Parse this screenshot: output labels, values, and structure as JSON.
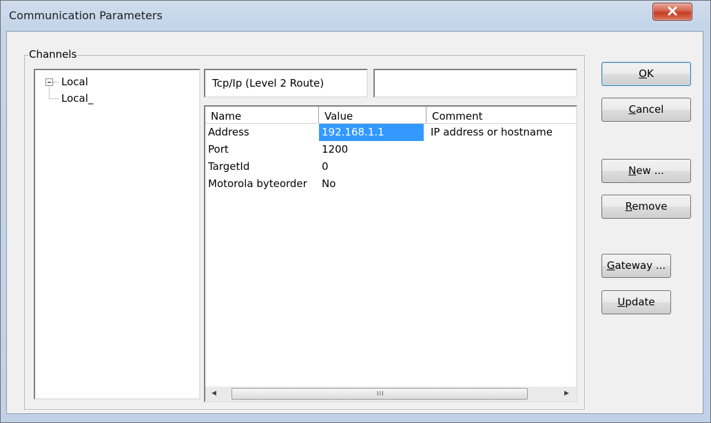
{
  "window": {
    "title": "Communication Parameters"
  },
  "channels": {
    "group_label": "Channels",
    "tree": [
      {
        "label": "Local",
        "expanded": true
      },
      {
        "label": "Local_"
      }
    ]
  },
  "channel_name": "Tcp/Ip (Level 2 Route)",
  "channel_description": "",
  "grid": {
    "columns": [
      "Name",
      "Value",
      "Comment"
    ],
    "rows": [
      {
        "name": "Address",
        "value": "192.168.1.1",
        "comment": "IP address or hostname"
      },
      {
        "name": "Port",
        "value": "1200",
        "comment": ""
      },
      {
        "name": "TargetId",
        "value": "0",
        "comment": ""
      },
      {
        "name": "Motorola byteorder",
        "value": "No",
        "comment": ""
      }
    ],
    "scroll_grip": "III"
  },
  "buttons": {
    "ok": {
      "first": "O",
      "rest": "K"
    },
    "cancel": {
      "first": "C",
      "rest": "ancel"
    },
    "new": {
      "first": "N",
      "rest": "ew ..."
    },
    "remove": {
      "first": "R",
      "rest": "emove"
    },
    "gateway": {
      "first": "G",
      "rest": "ateway ..."
    },
    "update": {
      "first": "U",
      "rest": "pdate"
    }
  },
  "colors": {
    "selection": "#3399ff",
    "close_button": "#c53d22"
  },
  "icons": {
    "close": "close-icon",
    "scroll_left": "scroll-left-arrow-icon",
    "scroll_right": "scroll-right-arrow-icon",
    "tree_expander": "tree-collapse-icon"
  }
}
